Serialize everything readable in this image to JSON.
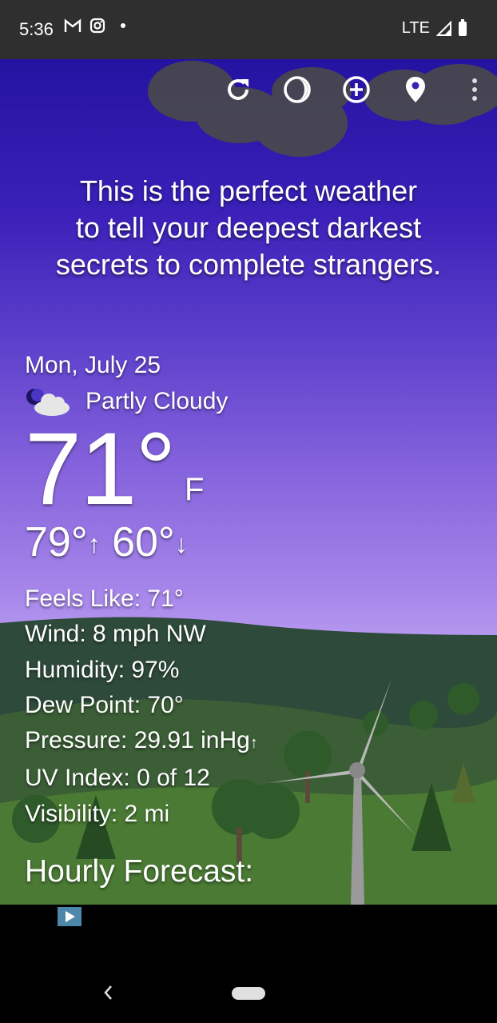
{
  "status_bar": {
    "time": "5:36",
    "network": "LTE",
    "icons": [
      "gmail-icon",
      "instagram-icon",
      "dot-icon",
      "signal-icon",
      "battery-icon"
    ]
  },
  "toolbar": {
    "icons": [
      "refresh-icon",
      "theme-icon",
      "add-location-icon",
      "location-pin-icon",
      "more-vert-icon"
    ]
  },
  "quote": {
    "line1": "This is the perfect weather",
    "line2": "to tell your deepest darkest",
    "line3": "secrets to complete strangers."
  },
  "weather": {
    "date": "Mon, July 25",
    "condition": "Partly Cloudy",
    "temperature": "71°",
    "unit": "F",
    "high": "79°",
    "low": "60°",
    "up_arrow": "↑",
    "down_arrow": "↓",
    "details": {
      "feels_like": "Feels Like:  71°",
      "wind": "Wind:  8 mph NW",
      "humidity": "Humidity:  97%",
      "dew_point": "Dew Point:  70°",
      "pressure": "Pressure:  29.91 inHg",
      "pressure_trend": "↑",
      "uv_index": "UV Index:  0 of 12",
      "visibility": "Visibility:  2 mi"
    }
  },
  "hourly": {
    "title": "Hourly Forecast:"
  },
  "colors": {
    "sky_top": "#2413a1",
    "sky_bottom": "#bfa4f2",
    "hill_dark": "#2e4a3a",
    "hill_green": "#3f6d2f"
  }
}
